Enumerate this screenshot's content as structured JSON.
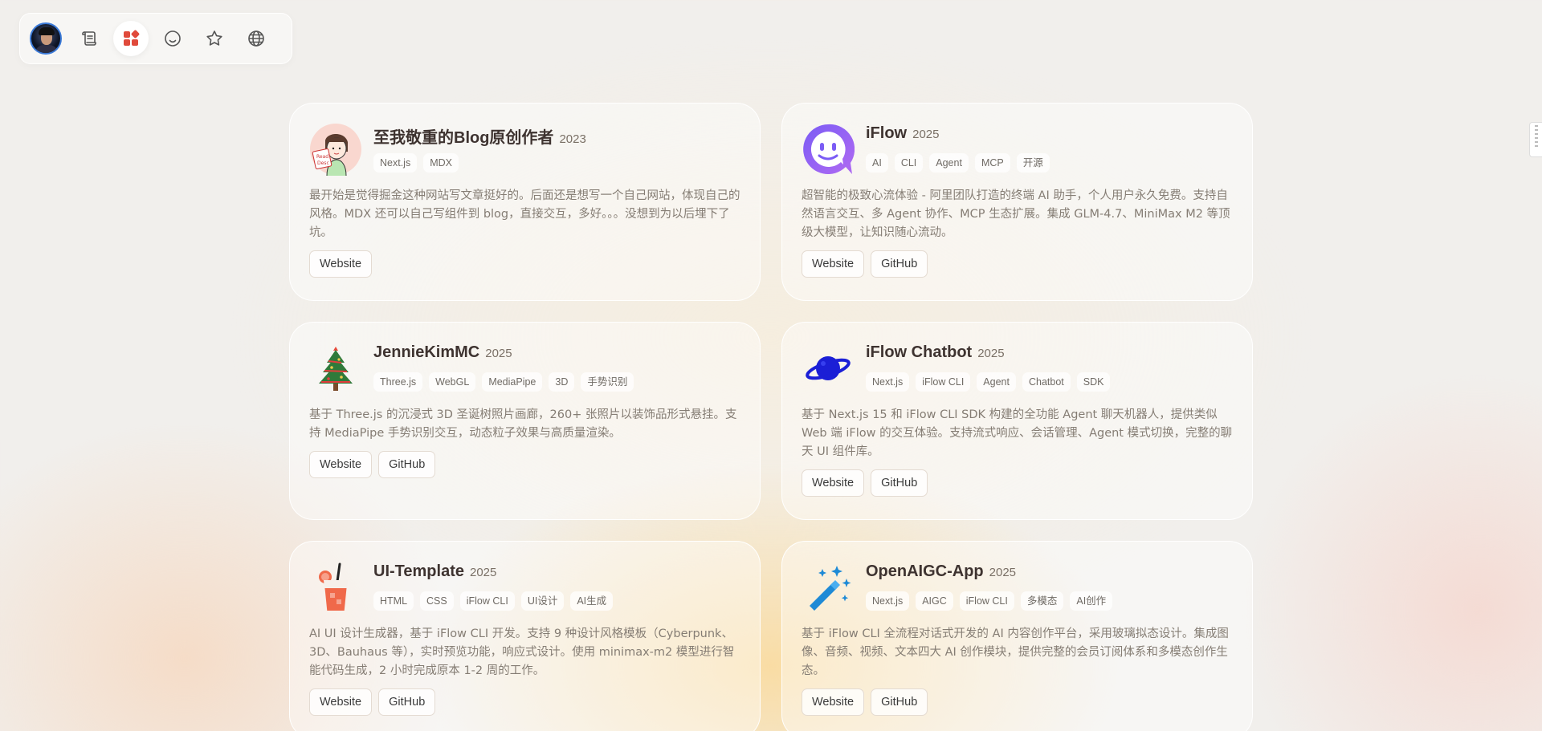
{
  "nav": {
    "items": [
      {
        "icon": "avatar",
        "active": false
      },
      {
        "icon": "scroll-icon",
        "active": false
      },
      {
        "icon": "apps-icon",
        "active": true
      },
      {
        "icon": "smile-icon",
        "active": false
      },
      {
        "icon": "star-icon",
        "active": false
      },
      {
        "icon": "globe-icon",
        "active": false
      }
    ]
  },
  "projects": [
    {
      "title": "至我敬重的Blog原创作者",
      "year": "2023",
      "tags": [
        "Next.js",
        "MDX"
      ],
      "description": "最开始是觉得掘金这种网站写文章挺好的。后面还是想写一个自己网站，体现自己的风格。MDX 还可以自己写组件到 blog，直接交互，多好。。。没想到为以后埋下了坑。",
      "buttons": [
        "Website"
      ],
      "icon": "reading-girl-icon"
    },
    {
      "title": "iFlow",
      "year": "2025",
      "tags": [
        "AI",
        "CLI",
        "Agent",
        "MCP",
        "开源"
      ],
      "description": "超智能的极致心流体验 - 阿里团队打造的终端 AI 助手，个人用户永久免费。支持自然语言交互、多 Agent 协作、MCP 生态扩展。集成 GLM-4.7、MiniMax M2 等顶级大模型，让知识随心流动。",
      "buttons": [
        "Website",
        "GitHub"
      ],
      "icon": "iflow-logo-icon"
    },
    {
      "title": "JennieKimMC",
      "year": "2025",
      "tags": [
        "Three.js",
        "WebGL",
        "MediaPipe",
        "3D",
        "手势识别"
      ],
      "description": "基于 Three.js 的沉浸式 3D 圣诞树照片画廊，260+ 张照片以装饰品形式悬挂。支持 MediaPipe 手势识别交互，动态粒子效果与高质量渲染。",
      "buttons": [
        "Website",
        "GitHub"
      ],
      "icon": "christmas-tree-icon"
    },
    {
      "title": "iFlow Chatbot",
      "year": "2025",
      "tags": [
        "Next.js",
        "iFlow CLI",
        "Agent",
        "Chatbot",
        "SDK"
      ],
      "description": "基于 Next.js 15 和 iFlow CLI SDK 构建的全功能 Agent 聊天机器人，提供类似 Web 端 iFlow 的交互体验。支持流式响应、会话管理、Agent 模式切换，完整的聊天 UI 组件库。",
      "buttons": [
        "Website",
        "GitHub"
      ],
      "icon": "planet-icon"
    },
    {
      "title": "UI-Template",
      "year": "2025",
      "tags": [
        "HTML",
        "CSS",
        "iFlow CLI",
        "UI设计",
        "AI生成"
      ],
      "description": "AI UI 设计生成器，基于 iFlow CLI 开发。支持 9 种设计风格模板（Cyberpunk、3D、Bauhaus 等），实时预览功能，响应式设计。使用 minimax-m2 模型进行智能代码生成，2 小时完成原本 1-2 周的工作。",
      "buttons": [
        "Website",
        "GitHub"
      ],
      "icon": "drink-icon"
    },
    {
      "title": "OpenAIGC-App",
      "year": "2025",
      "tags": [
        "Next.js",
        "AIGC",
        "iFlow CLI",
        "多模态",
        "AI创作"
      ],
      "description": "基于 iFlow CLI 全流程对话式开发的 AI 内容创作平台，采用玻璃拟态设计。集成图像、音频、视频、文本四大 AI 创作模块，提供完整的会员订阅体系和多模态创作生态。",
      "buttons": [
        "Website",
        "GitHub"
      ],
      "icon": "magic-wand-icon"
    }
  ]
}
